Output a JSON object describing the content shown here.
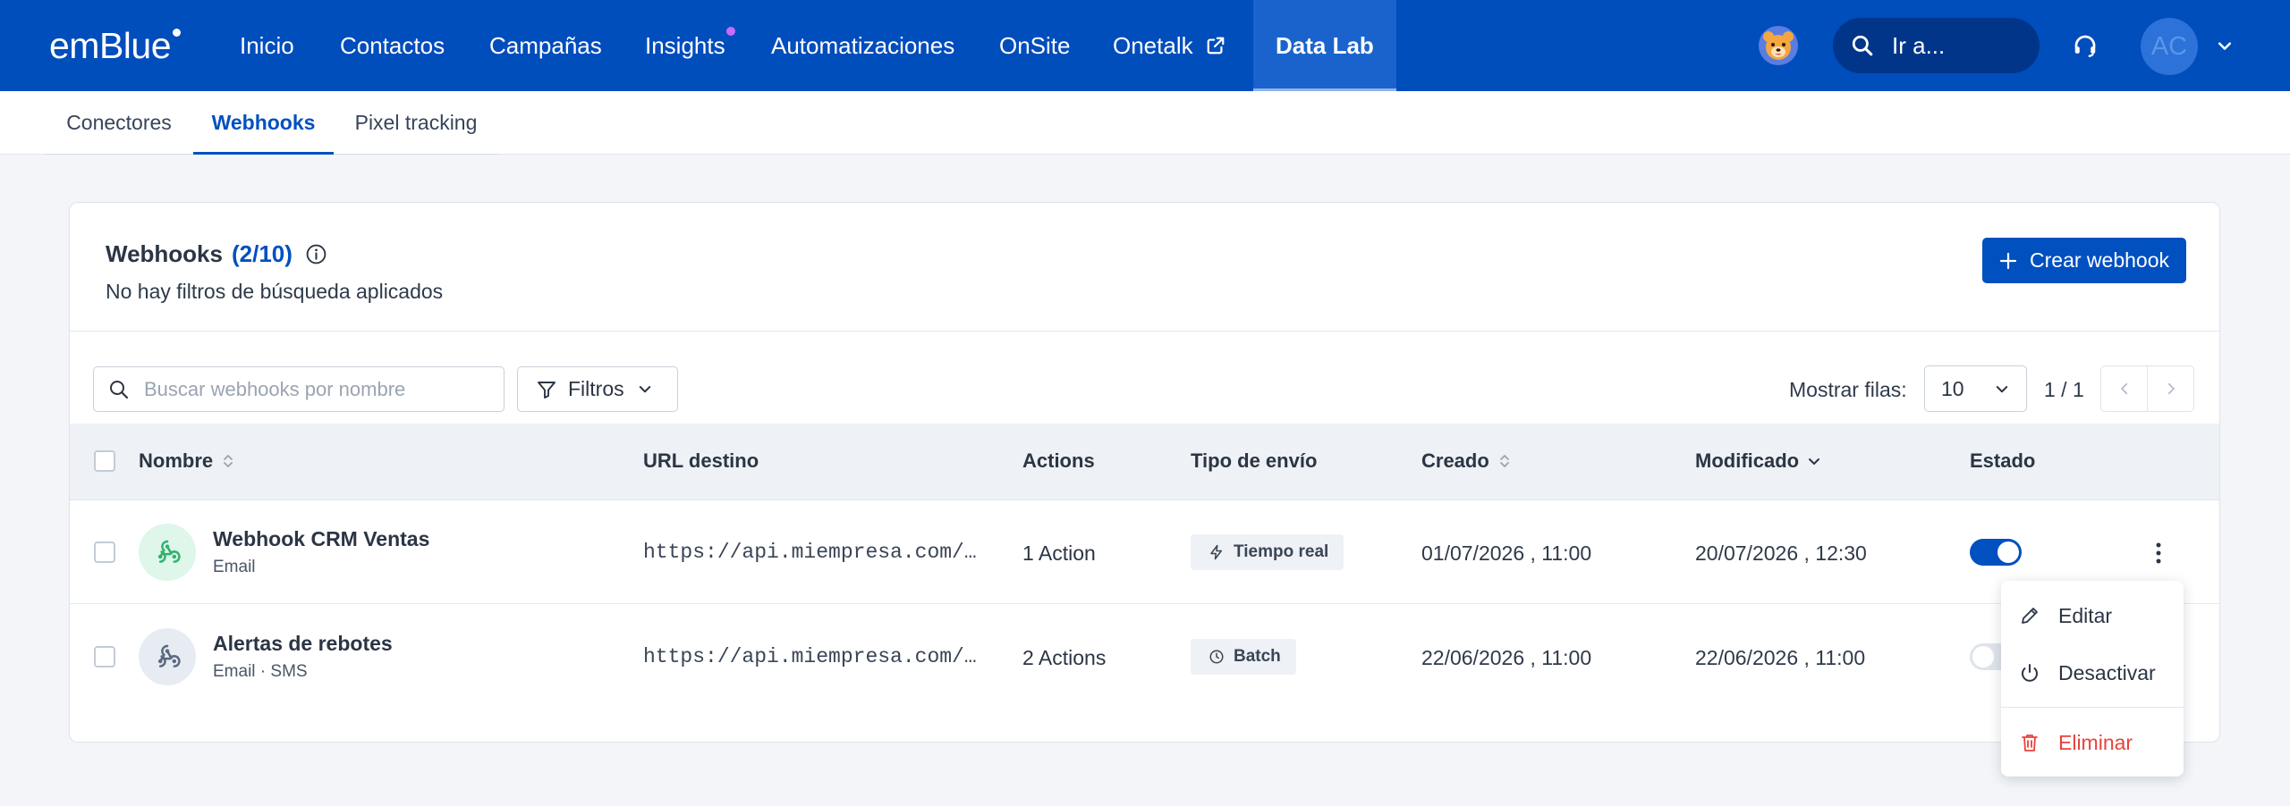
{
  "nav": {
    "logo": "emBlue",
    "items": [
      {
        "label": "Inicio"
      },
      {
        "label": "Contactos"
      },
      {
        "label": "Campañas"
      },
      {
        "label": "Insights"
      },
      {
        "label": "Automatizaciones"
      },
      {
        "label": "OnSite"
      },
      {
        "label": "Onetalk"
      },
      {
        "label": "Data Lab"
      }
    ],
    "search_label": "Ir a...",
    "avatar_initials": "AC"
  },
  "subtabs": [
    {
      "label": "Conectores"
    },
    {
      "label": "Webhooks"
    },
    {
      "label": "Pixel tracking"
    }
  ],
  "card": {
    "title": "Webhooks",
    "count": "(2/10)",
    "subtitle": "No hay filtros de búsqueda aplicados",
    "create_label": "Crear webhook"
  },
  "toolbar": {
    "search_placeholder": "Buscar webhooks por nombre",
    "filter_label": "Filtros",
    "rows_label": "Mostrar filas:",
    "rows_value": "10",
    "pager": "1 / 1"
  },
  "table": {
    "headers": {
      "name": "Nombre",
      "url": "URL destino",
      "actions": "Actions",
      "type": "Tipo de envío",
      "created": "Creado",
      "modified": "Modificado",
      "status": "Estado"
    },
    "rows": [
      {
        "name": "Webhook CRM Ventas",
        "sub": "Email",
        "url": "https://api.miempresa.com/webhooks/crm",
        "actions": "1 Action",
        "type": "Tiempo real",
        "created": "01/07/2026 , 11:00",
        "modified": "20/07/2026 , 12:30",
        "active": true
      },
      {
        "name": "Alertas de rebotes",
        "sub": "Email · SMS",
        "url": "https://api.miempresa.com/webhooks/rebotes",
        "actions": "2 Actions",
        "type": "Batch",
        "created": "22/06/2026 , 11:00",
        "modified": "22/06/2026 , 11:00",
        "active": false
      }
    ]
  },
  "menu": {
    "edit": "Editar",
    "deactivate": "Desactivar",
    "delete": "Eliminar"
  },
  "colors": {
    "brand": "#004dbc",
    "accent": "#0050c0",
    "danger": "#e8423b"
  }
}
